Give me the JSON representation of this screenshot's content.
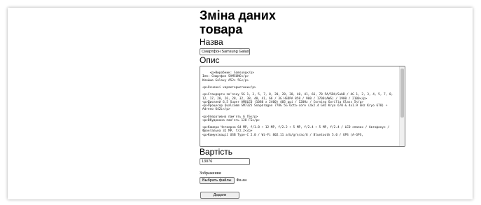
{
  "page": {
    "title": "Зміна даних товара",
    "name_label": "Назва",
    "name_value": "Смартфон Samsung Galaxy",
    "description_label": "Опис",
    "description_value": "<p>Виробник: Samsung</p>\nІмя: Смартфон SAMSUNG</p>\nКлеймо Galaxy A52s 5G</p>\n\n<p>Основні характеристики</p>\n\n<p>Стандарти зв'язку 5G 1, 3, 5, 7, 8, 20, 28, 38, 40, 41, 66, 78 5A/5DA/SubB / 4G 1, 2, 3, 4, 5, 7, 8, 12, 17, 20, 26, 28, 32, 38, 40, 41, 66 / 3G HSDPA 850 / 900 / 1700(AWS) / 1900 / 2100</p>\n<p>Дисплей 6.5 Super AMOLED (1080 x 2400) 405 ppi / 120Hz / Corning Gorilla Glass 5</p>\n<p>Процесор Qualcomm SM7325 Snapdragon 778G 5G Octa-core (4x2.4 GHz Kryo 670 & 4x1.9 GHz Kryo 670) + Adreno 642L</p>\n\n<p>Оперативна пам'ять 6 ГБ</p>\n<p>Вбудована пам'ять 128 ГБ</p>\n\n<p>Камера Четверна 64 MP, f/1.8 + 12 MP, f/2.2 + 5 MP, f/2.4 + 5 MP, f/2.4 / LED спалах / Автофокус / Фронтальна 32 MP, f/2.2</p>\n<p>Комунікації USB Type-C 2.0 / Wi-Fi 802.11 a/b/g/n/ac/6 / Bluetooth 5.0 / GPS (A-GPS,",
    "price_label": "Вартість",
    "price_value": "13076",
    "image_label": "Зображення",
    "file_button_label": "Выбрать файлы",
    "file_status": "Фа  ан",
    "submit_label": "Додати"
  }
}
